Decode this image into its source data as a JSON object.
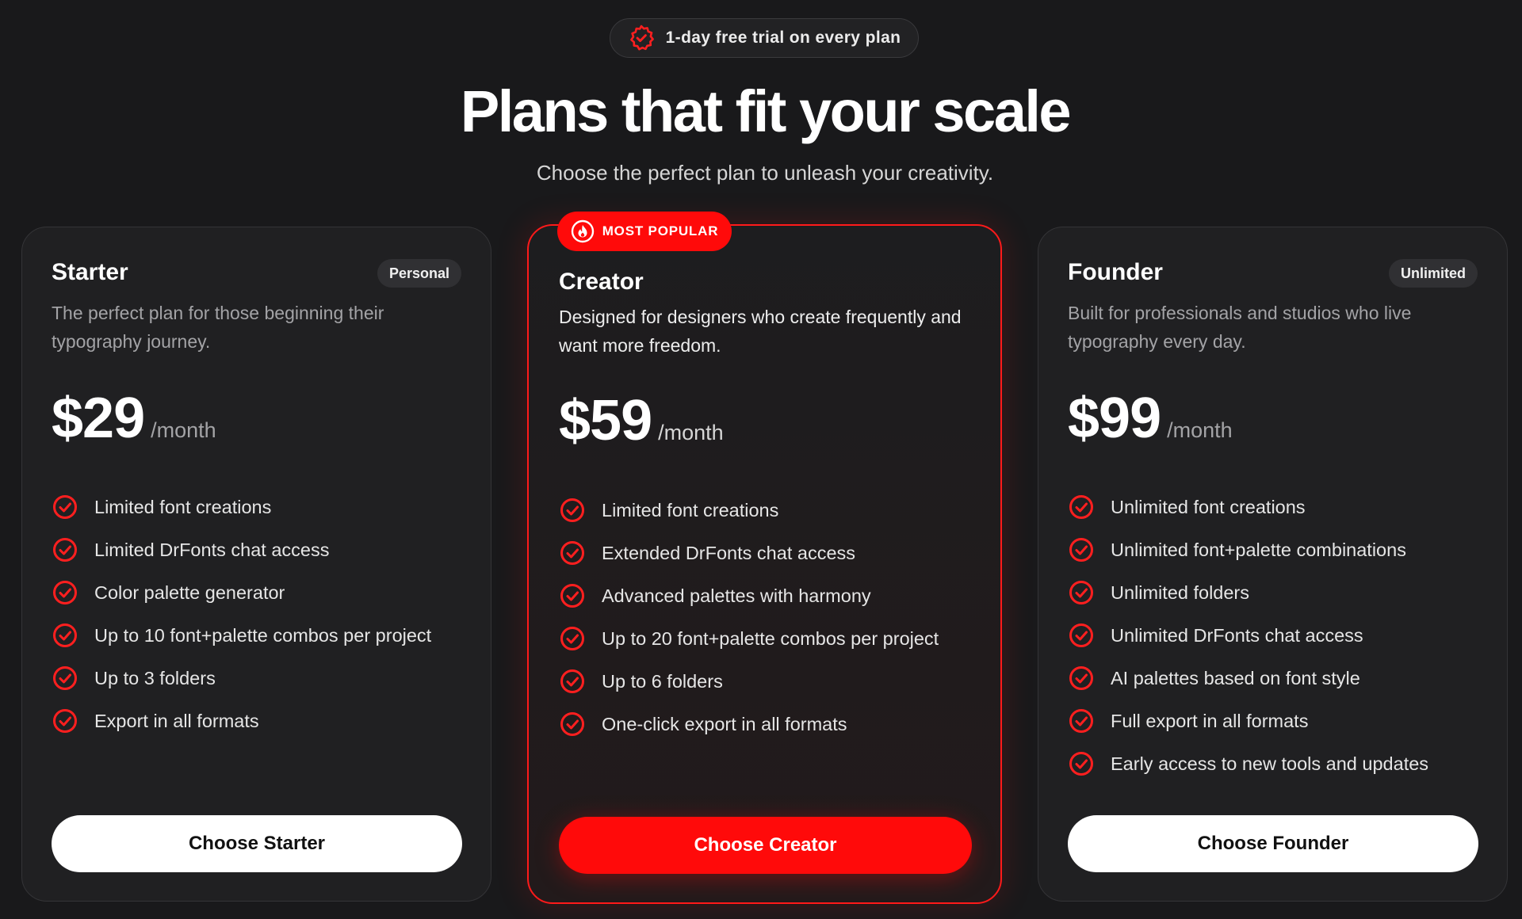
{
  "colors": {
    "background": "#19191b",
    "accent": "#ff0a0a",
    "card": "#202022"
  },
  "trial": {
    "icon": "verified-badge-icon",
    "text": "1-day free trial on every plan"
  },
  "header": {
    "title": "Plans that fit your scale",
    "subtitle": "Choose the perfect plan to unleash your creativity."
  },
  "plans": [
    {
      "name": "Starter",
      "tag": "Personal",
      "description": "The perfect plan for those beginning their typography journey.",
      "price": "$29",
      "period": "/month",
      "features": [
        "Limited font creations",
        "Limited DrFonts chat access",
        "Color palette generator",
        "Up to 10 font+palette combos per project",
        "Up to 3 folders",
        "Export in all formats"
      ],
      "cta": "Choose Starter"
    },
    {
      "name": "Creator",
      "badge": "MOST POPULAR",
      "badge_icon": "flame-icon",
      "description": "Designed for designers who create frequently and want more freedom.",
      "price": "$59",
      "period": "/month",
      "features": [
        "Limited font creations",
        "Extended DrFonts chat access",
        "Advanced palettes with harmony",
        "Up to 20 font+palette combos per project",
        "Up to 6 folders",
        "One-click export in all formats"
      ],
      "cta": "Choose Creator"
    },
    {
      "name": "Founder",
      "tag": "Unlimited",
      "description": "Built for professionals and studios who live typography every day.",
      "price": "$99",
      "period": "/month",
      "features": [
        "Unlimited font creations",
        "Unlimited font+palette combinations",
        "Unlimited folders",
        "Unlimited DrFonts chat access",
        "AI palettes based on font style",
        "Full export in all formats",
        "Early access to new tools and updates"
      ],
      "cta": "Choose Founder"
    }
  ]
}
